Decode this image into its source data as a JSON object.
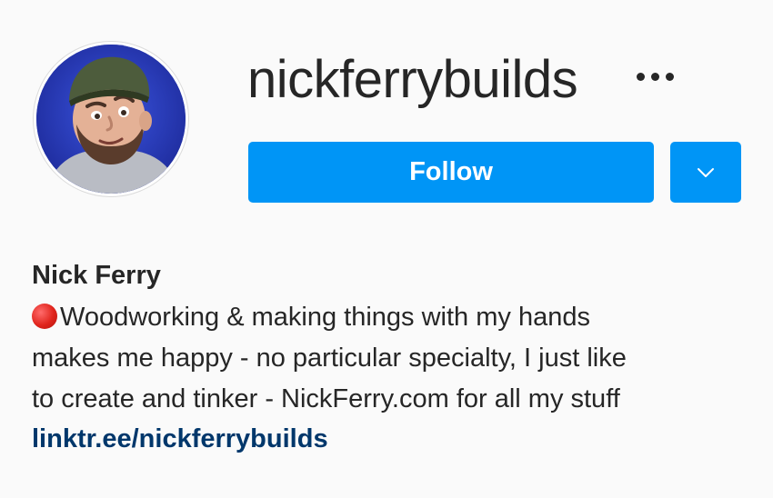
{
  "profile": {
    "username": "nickferrybuilds",
    "full_name": "Nick Ferry",
    "follow_label": "Follow",
    "bio_lines": [
      "Woodworking & making things with my hands",
      "makes me happy - no particular specialty, I just like",
      "to create and tinker - NickFerry.com for all my stuff"
    ],
    "link": "linktr.ee/nickferrybuilds"
  },
  "icons": {
    "more": "more-options-icon",
    "dropdown": "chevron-down-icon",
    "bio_emoji": "red-circle-icon"
  },
  "colors": {
    "accent": "#0095f6",
    "link": "#00376b",
    "text": "#262626",
    "background": "#fafafa",
    "red_circle": "#e0241c"
  }
}
